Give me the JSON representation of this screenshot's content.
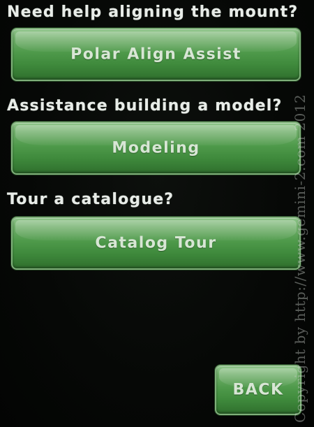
{
  "sections": [
    {
      "prompt": "Need help aligning the mount?",
      "button_label": "Polar Align Assist"
    },
    {
      "prompt": "Assistance building a model?",
      "button_label": "Modeling"
    },
    {
      "prompt": "Tour a catalogue?",
      "button_label": "Catalog Tour"
    }
  ],
  "back_button": {
    "label": "BACK"
  },
  "watermark": {
    "text": "Copyright by http://www.gemini-2.com 2012"
  },
  "colors": {
    "background": "#050605",
    "button_green": "#4f9a4b",
    "button_text": "#d8e6d5",
    "prompt_text": "#e8ece8"
  }
}
